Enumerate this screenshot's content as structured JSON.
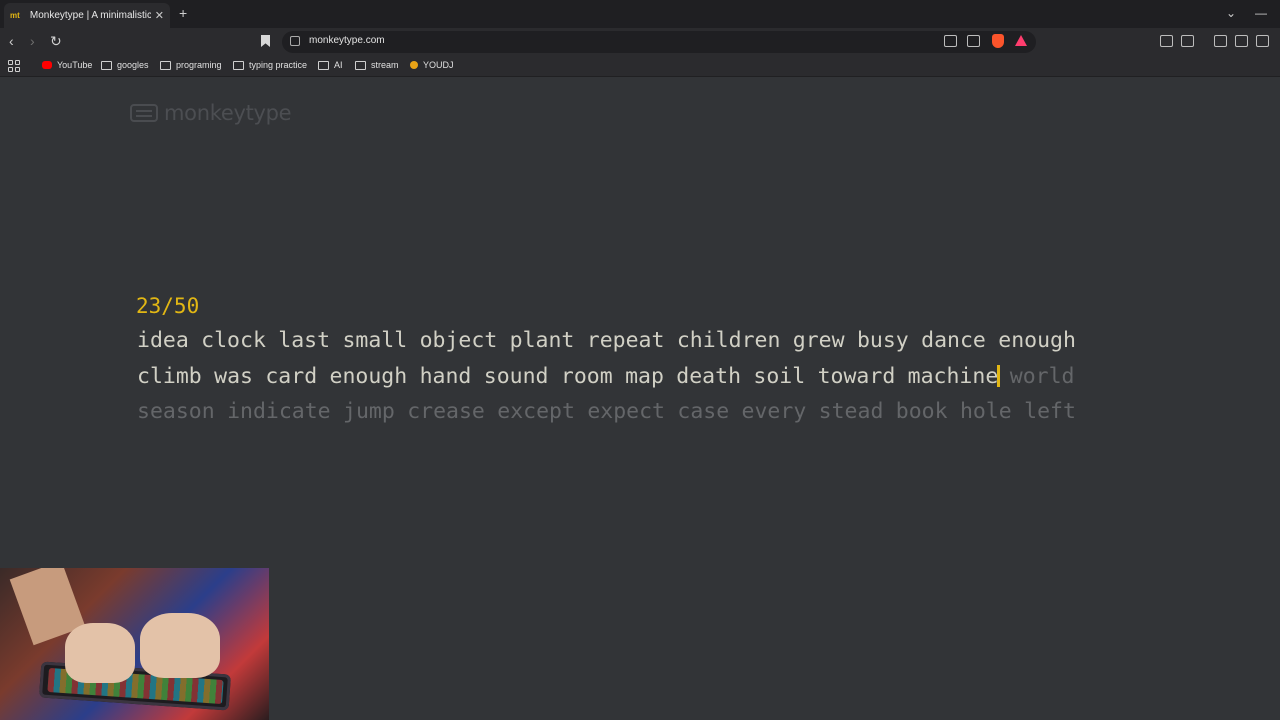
{
  "browser": {
    "tab_title": "Monkeytype | A minimalistic, cus",
    "tab_favicon": "mt",
    "url": "monkeytype.com",
    "bookmarks": [
      "YouTube",
      "googles",
      "programing",
      "typing practice",
      "AI",
      "stream",
      "YOUDJ"
    ]
  },
  "page": {
    "logo_text": "monkeytype",
    "counter": "23/50",
    "lines": [
      {
        "typed": [
          "idea",
          "clock",
          "last",
          "small",
          "object",
          "plant",
          "repeat",
          "children",
          "grew",
          "busy",
          "dance",
          "enough"
        ],
        "untyped": []
      },
      {
        "typed": [
          "climb",
          "was",
          "card",
          "enough",
          "hand",
          "sound",
          "room",
          "map",
          "death",
          "soil",
          "toward",
          "machine"
        ],
        "untyped": [
          "world"
        ]
      },
      {
        "typed": [],
        "untyped": [
          "season",
          "indicate",
          "jump",
          "crease",
          "except",
          "expect",
          "case",
          "every",
          "stead",
          "book",
          "hole",
          "left"
        ]
      }
    ]
  },
  "colors": {
    "background": "#323437",
    "main": "#e2b714",
    "text": "#d1d0c5",
    "sub": "#646669"
  }
}
